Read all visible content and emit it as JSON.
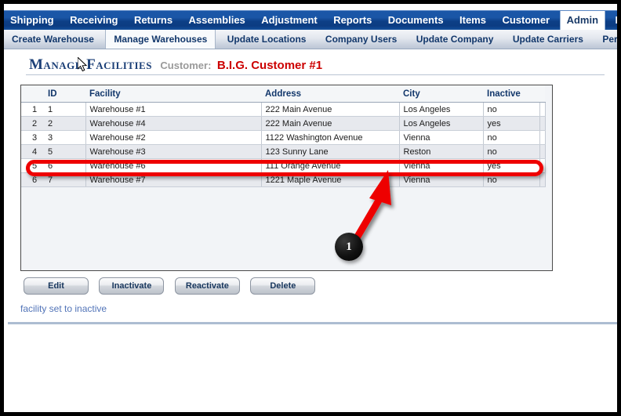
{
  "menu": {
    "items": [
      {
        "label": "Shipping",
        "active": false
      },
      {
        "label": "Receiving",
        "active": false
      },
      {
        "label": "Returns",
        "active": false
      },
      {
        "label": "Assemblies",
        "active": false
      },
      {
        "label": "Adjustment",
        "active": false
      },
      {
        "label": "Reports",
        "active": false
      },
      {
        "label": "Documents",
        "active": false
      },
      {
        "label": "Items",
        "active": false
      },
      {
        "label": "Customer",
        "active": false
      },
      {
        "label": "Admin",
        "active": true
      },
      {
        "label": "Hom",
        "active": false
      }
    ]
  },
  "tabs": {
    "items": [
      {
        "label": "Create Warehouse",
        "active": false
      },
      {
        "label": "Manage Warehouses",
        "active": true
      },
      {
        "label": "Update Locations",
        "active": false
      },
      {
        "label": "Company Users",
        "active": false
      },
      {
        "label": "Update Company",
        "active": false
      },
      {
        "label": "Update Carriers",
        "active": false
      },
      {
        "label": "Period Close",
        "active": false
      }
    ]
  },
  "heading": {
    "title": "Manage Facilities",
    "customer_label": "Customer:",
    "customer_value": "B.I.G. Customer #1"
  },
  "grid": {
    "columns": [
      "",
      "ID",
      "Facility",
      "Address",
      "City",
      "Inactive",
      ""
    ],
    "rows": [
      {
        "num": "1",
        "id": "1",
        "facility": "Warehouse #1",
        "address": "222 Main Avenue",
        "city": "Los Angeles",
        "inactive": "no"
      },
      {
        "num": "2",
        "id": "2",
        "facility": "Warehouse #4",
        "address": "222 Main Avenue",
        "city": "Los Angeles",
        "inactive": "yes"
      },
      {
        "num": "3",
        "id": "3",
        "facility": "Warehouse #2",
        "address": "1122 Washington Avenue",
        "city": "Vienna",
        "inactive": "no"
      },
      {
        "num": "4",
        "id": "5",
        "facility": "Warehouse #3",
        "address": "123 Sunny Lane",
        "city": "Reston",
        "inactive": "no"
      },
      {
        "num": "5",
        "id": "6",
        "facility": "Warehouse #6",
        "address": "111 Orange Avenue",
        "city": "Vienna",
        "inactive": "yes"
      },
      {
        "num": "6",
        "id": "7",
        "facility": "Warehouse #7",
        "address": "1221 Maple Avenue",
        "city": "Vienna",
        "inactive": "no"
      }
    ]
  },
  "annotation": {
    "badge_number": "1",
    "arrow_color": "#ee0000",
    "highlight_color": "#ee0000"
  },
  "buttons": {
    "edit": "Edit",
    "inactivate": "Inactivate",
    "reactivate": "Reactivate",
    "delete": "Delete"
  },
  "status": {
    "message": "facility set to inactive",
    "color": "#5274b8"
  }
}
